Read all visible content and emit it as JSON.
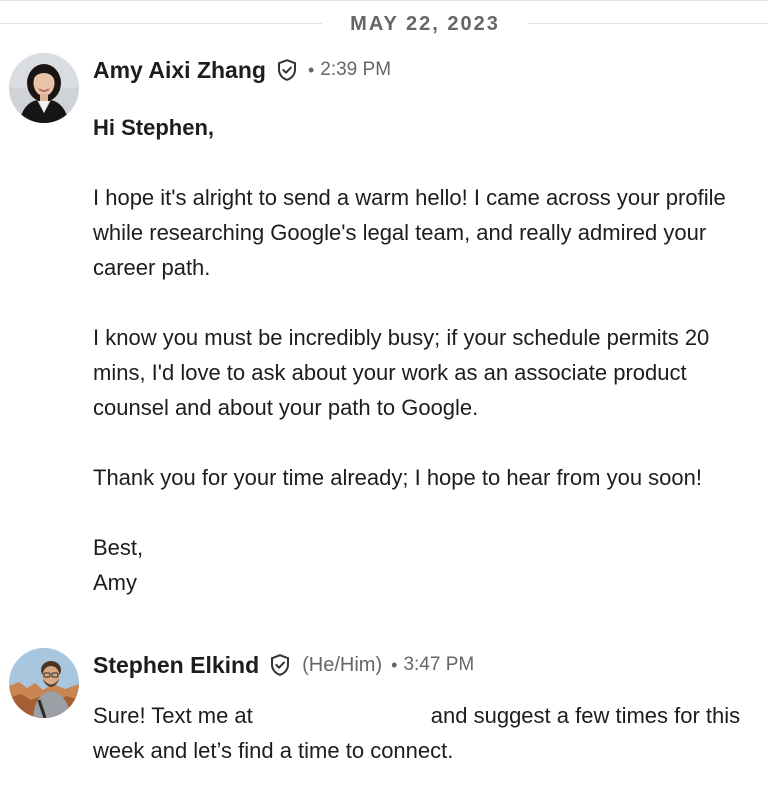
{
  "date_divider": "MAY 22, 2023",
  "messages": [
    {
      "sender": "Amy Aixi Zhang",
      "pronouns": "",
      "separator": "•",
      "time": "2:39 PM",
      "greeting": "Hi Stephen,",
      "paragraphs": [
        "I hope it's alright to send a warm hello! I came across your profile while researching Google's legal team, and really admired your career path.",
        "I know you must be incredibly busy; if your schedule permits 20 mins, I'd love to ask about your work as an associate product counsel and about your path to Google.",
        "Thank you for your time already; I hope to hear from you soon!"
      ],
      "signoff": "Best,",
      "signature": "Amy"
    },
    {
      "sender": "Stephen Elkind",
      "pronouns": "(He/Him)",
      "separator": "•",
      "time": "3:47 PM",
      "text_before": "Sure! Text me at",
      "text_after": "and suggest a few times for this week and let’s find a time to connect."
    }
  ],
  "icons": {
    "verified": "verified-shield-icon"
  },
  "colors": {
    "text": "#1d1d1d",
    "meta": "#666666",
    "divider": "#e3e3e3"
  }
}
